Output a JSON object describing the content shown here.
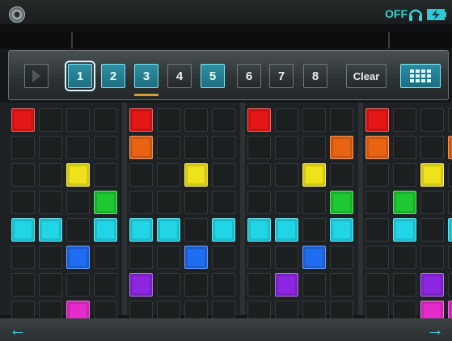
{
  "statusbar": {
    "power_label": "OFF",
    "icons": [
      "disc-icon",
      "headphones-icon",
      "battery-charging-icon"
    ]
  },
  "toolbar": {
    "play_icon": "play-icon",
    "patterns": [
      {
        "label": "1",
        "state": "active-selected"
      },
      {
        "label": "2",
        "state": "active"
      },
      {
        "label": "3",
        "state": "active-current"
      },
      {
        "label": "4",
        "state": "inactive"
      },
      {
        "label": "5",
        "state": "active"
      },
      {
        "label": "6",
        "state": "inactive"
      },
      {
        "label": "7",
        "state": "inactive"
      },
      {
        "label": "8",
        "state": "inactive"
      }
    ],
    "clear_label": "Clear",
    "grid_icon": "grid-view-icon"
  },
  "sequencer": {
    "steps": 16,
    "rows": [
      {
        "color": "#e51717",
        "steps": [
          0,
          4,
          8,
          12
        ]
      },
      {
        "color": "#e86413",
        "steps": [
          4,
          11,
          12,
          15
        ]
      },
      {
        "color": "#efe21a",
        "steps": [
          2,
          6,
          10,
          14
        ]
      },
      {
        "color": "#1dc832",
        "steps": [
          3,
          11,
          13
        ]
      },
      {
        "color": "#20d6e6",
        "steps": [
          0,
          1,
          3,
          4,
          5,
          7,
          8,
          9,
          11,
          13,
          15
        ]
      },
      {
        "color": "#1f6df0",
        "steps": [
          2,
          6,
          10
        ]
      },
      {
        "color": "#8c26e0",
        "steps": [
          4,
          9,
          14
        ]
      },
      {
        "color": "#e52bc9",
        "steps": [
          2,
          14,
          15
        ]
      }
    ]
  },
  "nav": {
    "back_icon": "arrow-left-icon",
    "forward_icon": "arrow-right-icon"
  }
}
